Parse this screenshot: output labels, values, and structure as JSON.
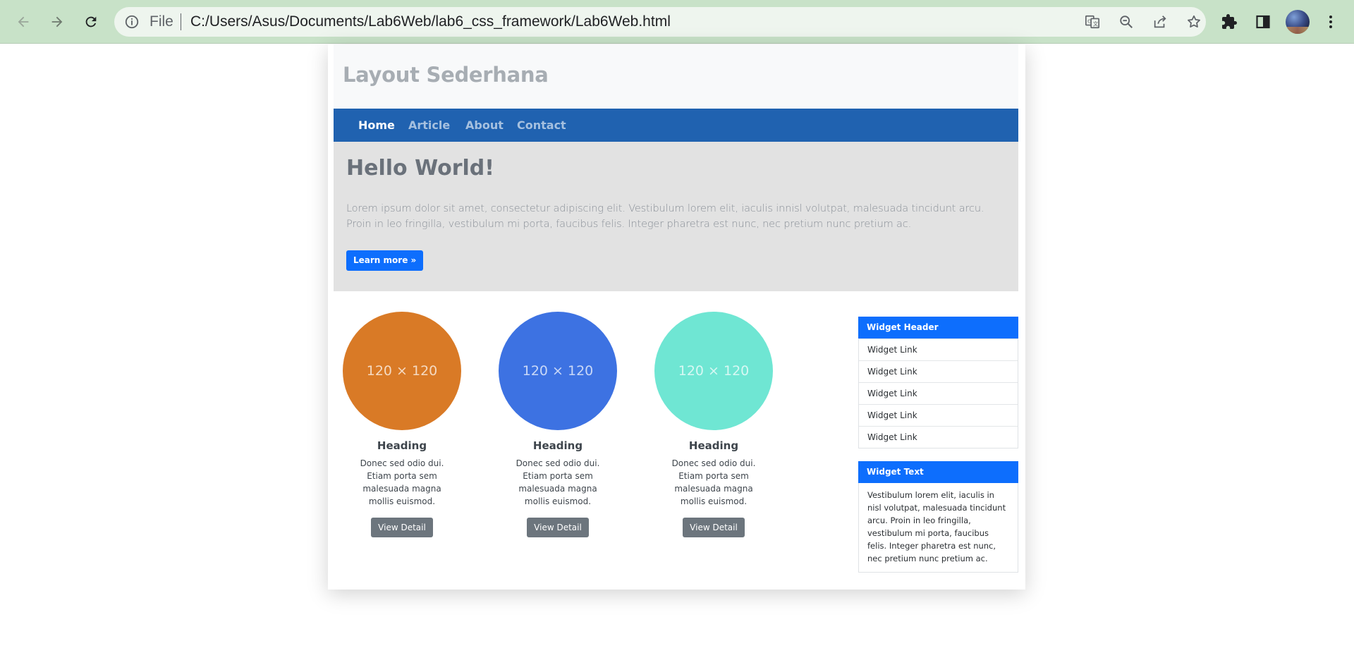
{
  "browser": {
    "file_label": "File",
    "url": "C:/Users/Asus/Documents/Lab6Web/lab6_css_framework/Lab6Web.html"
  },
  "site": {
    "title": "Layout Sederhana"
  },
  "nav": {
    "items": [
      {
        "label": "Home",
        "active": true
      },
      {
        "label": "Article",
        "active": false
      },
      {
        "label": "About",
        "active": false
      },
      {
        "label": "Contact",
        "active": false
      }
    ]
  },
  "hero": {
    "heading": "Hello World!",
    "text": "Lorem ipsum dolor sit amet, consectetur adipiscing elit. Vestibulum lorem elit, iaculis innisl volutpat, malesuada tincidunt arcu. Proin in leo fringilla, vestibulum mi porta, faucibus felis. Integer pharetra est nunc, nec pretium nunc pretium ac.",
    "button_label": "Learn more »"
  },
  "features": [
    {
      "placeholder": "120 × 120",
      "color": "#d97a26",
      "heading": "Heading",
      "text": "Donec sed odio dui. Etiam porta sem malesuada magna mollis euismod.",
      "button_label": "View Detail"
    },
    {
      "placeholder": "120 × 120",
      "color": "#3d72e2",
      "heading": "Heading",
      "text": "Donec sed odio dui. Etiam porta sem malesuada magna mollis euismod.",
      "button_label": "View Detail"
    },
    {
      "placeholder": "120 × 120",
      "color": "#6fe6d3",
      "heading": "Heading",
      "text": "Donec sed odio dui. Etiam porta sem malesuada magna mollis euismod.",
      "button_label": "View Detail"
    }
  ],
  "widgets": {
    "links_header": "Widget Header",
    "links": [
      "Widget Link",
      "Widget Link",
      "Widget Link",
      "Widget Link",
      "Widget Link"
    ],
    "text_header": "Widget Text",
    "text": "Vestibulum lorem elit, iaculis in nisl volutpat, malesuada tincidunt arcu. Proin in leo fringilla, vestibulum mi porta, faucibus felis. Integer pharetra est nunc, nec pretium nunc pretium ac."
  },
  "colors": {
    "navbar": "#2062b0",
    "primary": "#0d6efd",
    "secondary": "#6c757d",
    "chrome": "#c8e2c8"
  }
}
